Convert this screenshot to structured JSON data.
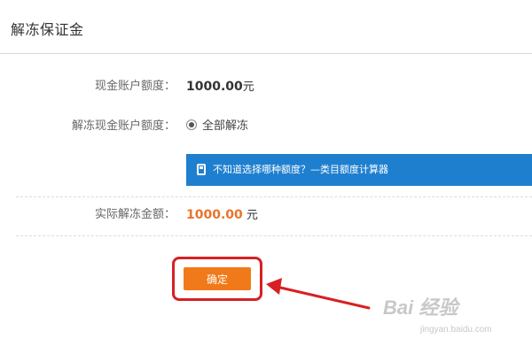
{
  "dialog": {
    "title": "解冻保证金"
  },
  "form": {
    "cash_limit": {
      "label": "现金账户额度：",
      "amount": "1000.00",
      "unit": "元"
    },
    "unfreeze_limit": {
      "label": "解冻现金账户额度：",
      "option_label": "全部解冻",
      "selected": true
    },
    "info_bar": {
      "text": "不知道选择哪种额度？—类目额度计算器",
      "icon": "calculator-icon",
      "color": "#1f7fcf"
    },
    "actual_amount": {
      "label": "实际解冻金额：",
      "amount": "1000.00",
      "unit": "元",
      "color": "#e8742b"
    }
  },
  "actions": {
    "confirm_label": "确定",
    "confirm_color": "#f07a1a",
    "highlight_color": "#d72024"
  },
  "watermark": {
    "logo_text": "Bai 经验",
    "url": "jingyan.baidu.com"
  }
}
